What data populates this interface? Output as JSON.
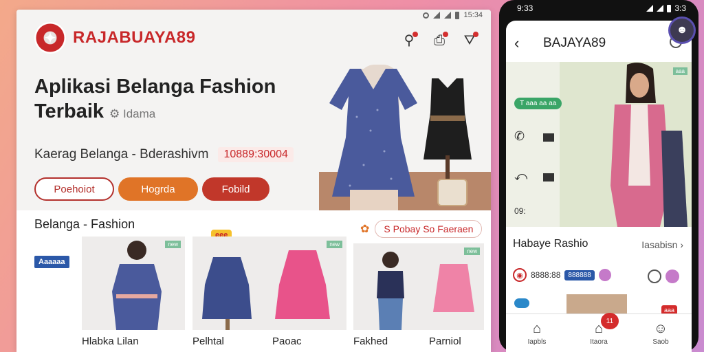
{
  "web": {
    "status_time": "15:34",
    "brand": "RAJABUAYA89",
    "title_line1": "Aplikasi Belanga Fashion",
    "title_line2": "Terbaik",
    "title_sub": "Idama",
    "tagline": "Kaerag Belanga - Bderashivm",
    "price": "10889:30004",
    "buttons": [
      "Poehoiot",
      "Hogrda",
      "Fobild"
    ],
    "section_title": "Belanga - Fashion",
    "promo_text": "S Pobay So Faeraen",
    "side_badge": "Aaaaaa",
    "new_badge": "eee",
    "products": [
      {
        "name": "Hlabka Lilan"
      },
      {
        "name": "Pelhtal"
      },
      {
        "name": "Paoac"
      },
      {
        "name": "Fakhed"
      },
      {
        "name": "Parniol"
      }
    ],
    "colors": {
      "brand_red": "#c8282a",
      "accent_orange": "#e07427",
      "dress_blue": "#4a5a9c",
      "pink": "#e8538a"
    },
    "icons": [
      "search-icon",
      "bag-icon",
      "cart-icon"
    ]
  },
  "phone": {
    "status_time": "9:33",
    "status_right": "3:3",
    "app_title": "BAJAYA89",
    "green_chip": "T aaa aa aa",
    "hero_tag": "aaa",
    "code_label": "09:",
    "category_title": "Habaye Rashio",
    "category_link": "Iasabisn",
    "feature_text": "8888:88",
    "feature_pill": "888888",
    "red_chip": "aaa",
    "nav": [
      {
        "icon": "home-icon",
        "label": "Iapbls"
      },
      {
        "icon": "bag-icon",
        "label": "Itaora",
        "badge": "11"
      },
      {
        "icon": "user-icon",
        "label": "Saob"
      }
    ]
  }
}
